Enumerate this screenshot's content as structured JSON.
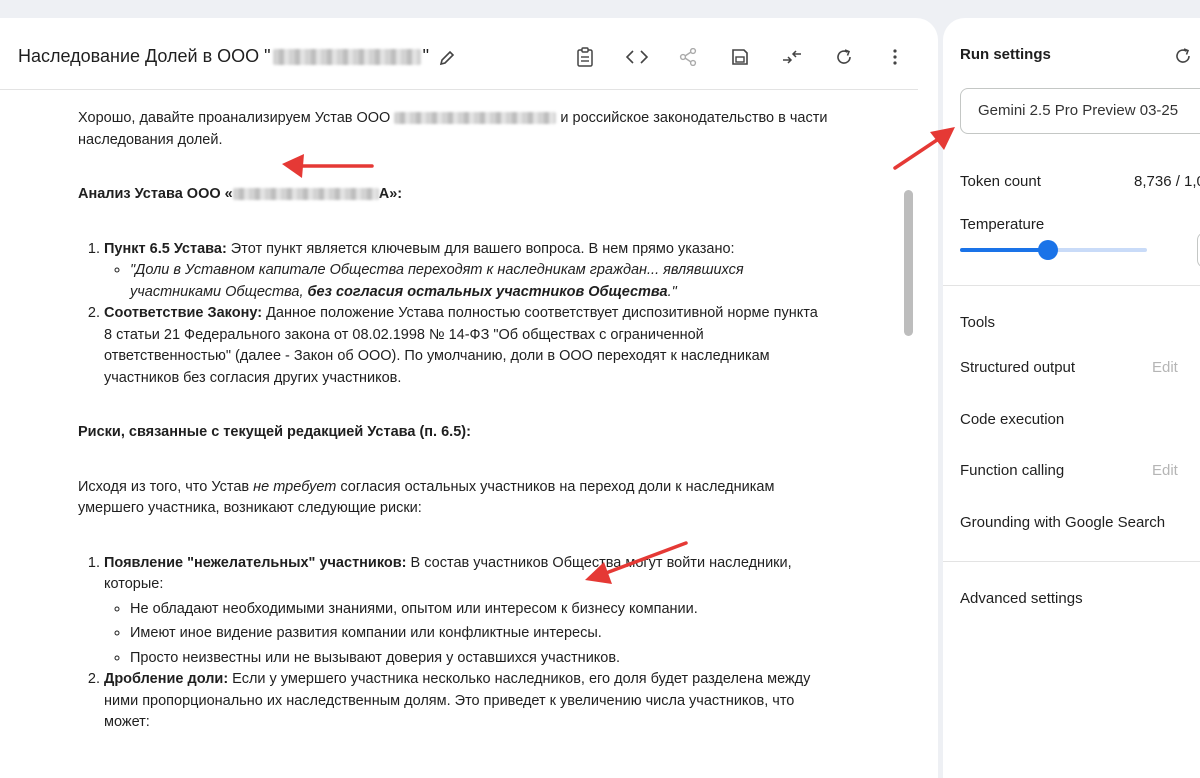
{
  "chat": {
    "title_prefix": "Наследование Долей в ООО \"",
    "title_suffix": "\"",
    "p1_a": "Хорошо, давайте проанализируем Устав ООО",
    "p1_b": "и российское законодательство в части наследования долей.",
    "h1_a": "Анализ Устава ООО «",
    "h1_b": "А»:",
    "item1_label": "Пункт 6.5 Устава:",
    "item1_text": " Этот пункт является ключевым для вашего вопроса. В нем прямо указано:",
    "item1_quote_a": "\"Доли в Уставном капитале Общества переходят к наследникам граждан... являвшихся участниками Общества, ",
    "item1_quote_b": "без согласия остальных участников Общества",
    "item1_quote_c": ".\"",
    "item2_label": "Соответствие Закону:",
    "item2_text": " Данное положение Устава полностью соответствует диспозитивной норме пункта 8 статьи 21 Федерального закона от 08.02.1998 № 14-ФЗ \"Об обществах с ограниченной ответственностью\" (далее - Закон об ООО). По умолчанию, доли в ООО переходят к наследникам участников без согласия других участников.",
    "h2": "Риски, связанные с текущей редакцией Устава (п. 6.5):",
    "p2_a": "Исходя из того, что Устав ",
    "p2_em": "не требует",
    "p2_b": " согласия остальных участников на переход доли к наследникам умершего участника, возникают следующие риски:",
    "risk1_label": "Появление \"нежелательных\" участников:",
    "risk1_text": " В состав участников Общества могут войти наследники, которые:",
    "risk1_subs": [
      "Не обладают необходимыми знаниями, опытом или интересом к бизнесу компании.",
      "Имеют иное видение развития компании или конфликтные интересы.",
      "Просто неизвестны или не вызывают доверия у оставшихся участников."
    ],
    "risk2_label": "Дробление доли:",
    "risk2_text": " Если у умершего участника несколько наследников, его доля будет разделена между ними пропорционально их наследственным долям. Это приведет к увеличению числа участников, что может:"
  },
  "settings": {
    "title": "Run settings",
    "model": "Gemini 2.5 Pro Preview 03-25",
    "token_label": "Token count",
    "token_value": "8,736 / 1,0",
    "temperature_label": "Temperature",
    "temperature_value": 0.47,
    "tools_label": "Tools",
    "structured_output": "Structured output",
    "code_execution": "Code execution",
    "function_calling": "Function calling",
    "grounding": "Grounding with Google Search",
    "edit": "Edit",
    "advanced": "Advanced settings"
  }
}
